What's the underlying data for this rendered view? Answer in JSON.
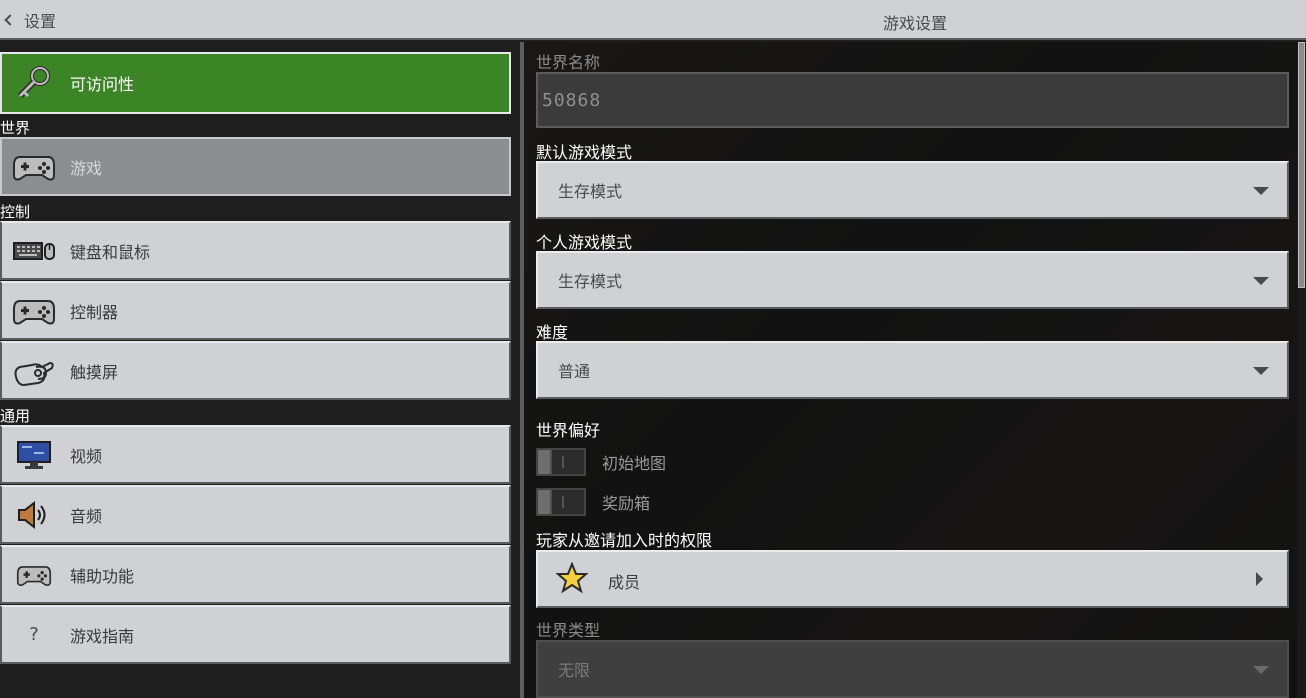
{
  "header": {
    "back_label": "设置",
    "page_title": "游戏设置"
  },
  "sidebar": {
    "top_item": {
      "label": "可访问性",
      "icon": "key-icon"
    },
    "sections": {
      "world": "世界",
      "controls": "控制",
      "general": "通用"
    },
    "world_items": [
      {
        "label": "游戏",
        "icon": "controller-icon",
        "state": "selected"
      }
    ],
    "control_items": [
      {
        "label": "键盘和鼠标",
        "icon": "keyboard-mouse-icon"
      },
      {
        "label": "控制器",
        "icon": "controller-icon"
      },
      {
        "label": "触摸屏",
        "icon": "touch-hand-icon"
      }
    ],
    "general_items": [
      {
        "label": "视频",
        "icon": "monitor-icon"
      },
      {
        "label": "音频",
        "icon": "speaker-icon"
      },
      {
        "label": "辅助功能",
        "icon": "controller-icon"
      },
      {
        "label": "游戏指南",
        "icon": "question-icon"
      }
    ],
    "question_glyph": "?"
  },
  "main": {
    "world_name": {
      "label": "世界名称",
      "value": "50868"
    },
    "default_game_mode": {
      "label": "默认游戏模式",
      "value": "生存模式"
    },
    "personal_game_mode": {
      "label": "个人游戏模式",
      "value": "生存模式"
    },
    "difficulty": {
      "label": "难度",
      "value": "普通"
    },
    "world_preferences": {
      "label": "世界偏好",
      "toggles": [
        {
          "label": "初始地图",
          "on": false
        },
        {
          "label": "奖励箱",
          "on": false
        }
      ]
    },
    "invite_permission": {
      "label": "玩家从邀请加入时的权限",
      "value": "成员",
      "icon": "star-icon"
    },
    "world_type": {
      "label": "世界类型",
      "value": "无限",
      "disabled": true
    }
  },
  "colors": {
    "accent_green": "#3c8527",
    "button_gray": "#d0d1d4",
    "background": "#1e1e1f"
  }
}
